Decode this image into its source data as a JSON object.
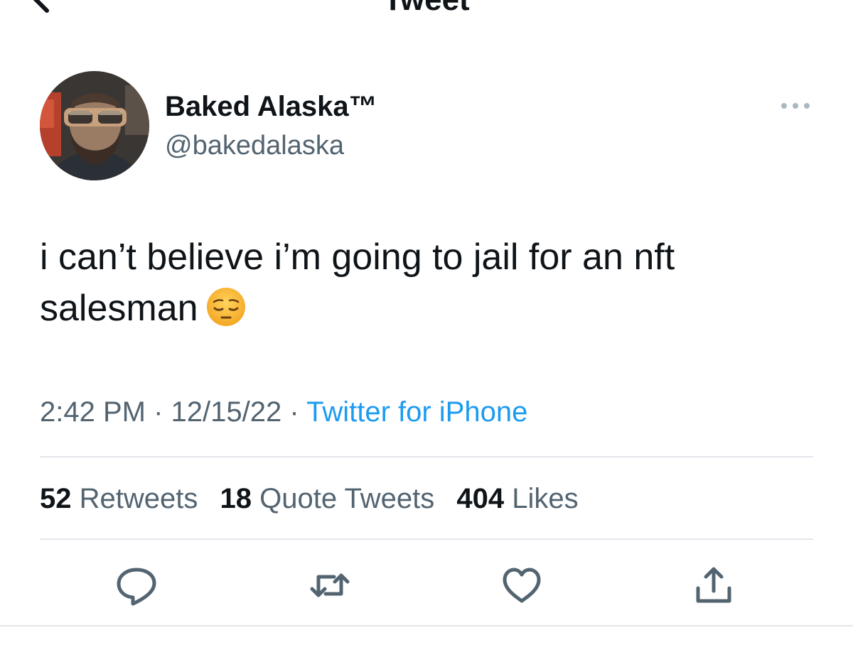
{
  "header": {
    "title": "Tweet"
  },
  "tweet": {
    "display_name": "Baked Alaska™",
    "handle": "@bakedalaska",
    "text_line1": "i can’t believe i’m going to jail for an nft",
    "text_line2": "salesman",
    "emoji": "pensive-face",
    "time": "2:42 PM",
    "date": "12/15/22",
    "source": "Twitter for iPhone",
    "separator": "·"
  },
  "stats": {
    "retweets_count": "52",
    "retweets_label": "Retweets",
    "quotes_count": "18",
    "quotes_label": "Quote Tweets",
    "likes_count": "404",
    "likes_label": "Likes"
  },
  "icons": {
    "back": "arrow-left-icon",
    "more": "more-horizontal-icon",
    "reply": "reply-icon",
    "retweet": "retweet-icon",
    "like": "heart-icon",
    "share": "share-icon"
  },
  "colors": {
    "text": "#0f1419",
    "secondary": "#536471",
    "link": "#1d9bf0",
    "divider": "#e1e6ea"
  }
}
